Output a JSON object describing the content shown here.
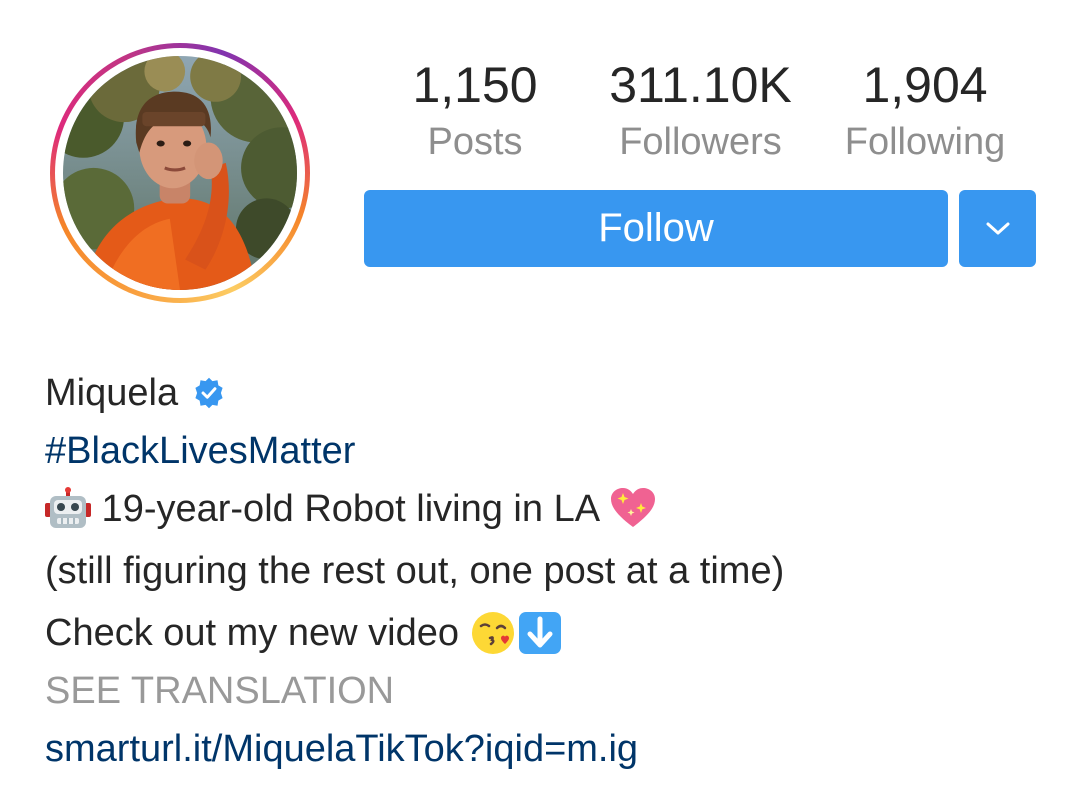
{
  "profile": {
    "avatar_icon": "profile-photo",
    "stats": {
      "posts": {
        "value": "1,150",
        "label": "Posts"
      },
      "followers": {
        "value": "311.10K",
        "label": "Followers"
      },
      "following": {
        "value": "1,904",
        "label": "Following"
      }
    },
    "actions": {
      "follow_label": "Follow",
      "dropdown_icon": "chevron-down-icon"
    },
    "username": "Miquela",
    "verified_icon": "verified-badge-icon",
    "bio": {
      "hashtag": "#BlackLivesMatter",
      "line1_text": " 19-year-old Robot living in LA ",
      "line1_icons": [
        "robot-emoji",
        "sparkling-heart-emoji"
      ],
      "line2": "(still figuring the rest out, one post at a time)",
      "line3_text": "Check out my new video ",
      "line3_icons": [
        "kissing-face-emoji",
        "down-arrow-emoji"
      ],
      "see_translation": "SEE TRANSLATION",
      "link": "smarturl.it/MiquelaTikTok?iqid=m.ig"
    },
    "colors": {
      "follow_button": "#3897f0",
      "hashtag_link": "#003569",
      "muted": "#8e8e8e"
    }
  }
}
